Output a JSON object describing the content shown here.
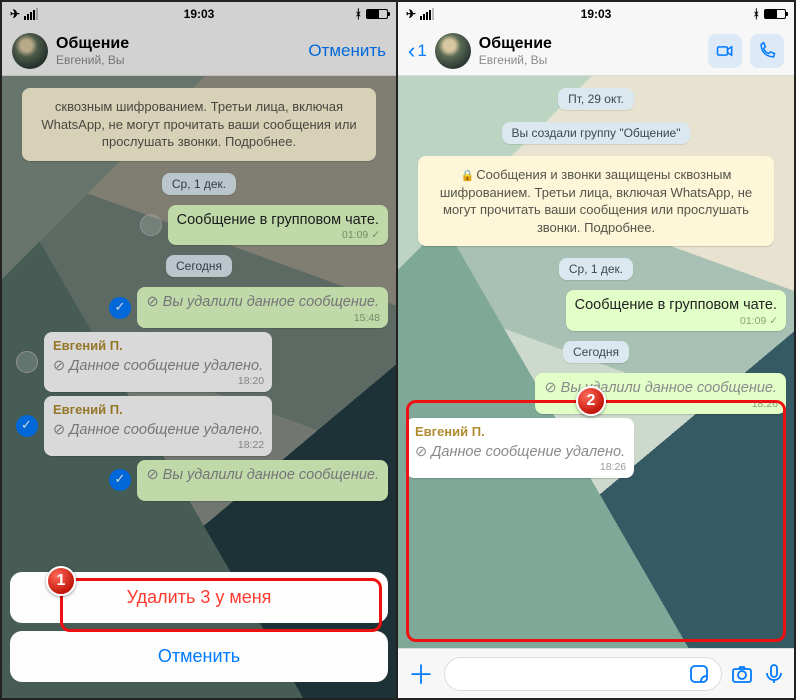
{
  "status": {
    "time": "19:03"
  },
  "left": {
    "header": {
      "name": "Общение",
      "sub": "Евгений, Вы",
      "cancel": "Отменить"
    },
    "enc_notice": "сквозным шифрованием. Третьи лица, включая WhatsApp, не могут прочитать ваши сообщения или прослушать звонки. Подробнее.",
    "date1": "Ср, 1 дек.",
    "msg1": {
      "text": "Сообщение в групповом чате.",
      "time": "01:09"
    },
    "date2": "Сегодня",
    "del_out1": {
      "text": "Вы удалили данное сообщение.",
      "time": "15:48"
    },
    "in1": {
      "sender": "Евгений П.",
      "text": "Данное сообщение удалено.",
      "time": "18:20"
    },
    "in2": {
      "sender": "Евгений П.",
      "text": "Данное сообщение удалено.",
      "time": "18:22"
    },
    "del_out2": {
      "text": "Вы удалили данное сообщение.",
      "time": ""
    },
    "sheet": {
      "delete": "Удалить 3 у меня",
      "cancel": "Отменить"
    },
    "badge": "1"
  },
  "right": {
    "header": {
      "back_count": "1",
      "name": "Общение",
      "sub": "Евгений, Вы"
    },
    "date0": "Пт, 29 окт.",
    "created": "Вы создали группу \"Общение\"",
    "enc_notice": "Сообщения и звонки защищены сквозным шифрованием. Третьи лица, включая WhatsApp, не могут прочитать ваши сообщения или прослушать звонки. Подробнее.",
    "date1": "Ср, 1 дек.",
    "msg1": {
      "text": "Сообщение в групповом чате.",
      "time": "01:09"
    },
    "date2": "Сегодня",
    "del_out": {
      "text": "Вы удалили данное сообщение.",
      "time": "18:26"
    },
    "in1": {
      "sender": "Евгений П.",
      "text": "Данное сообщение удалено.",
      "time": "18:26"
    },
    "badge": "2"
  }
}
